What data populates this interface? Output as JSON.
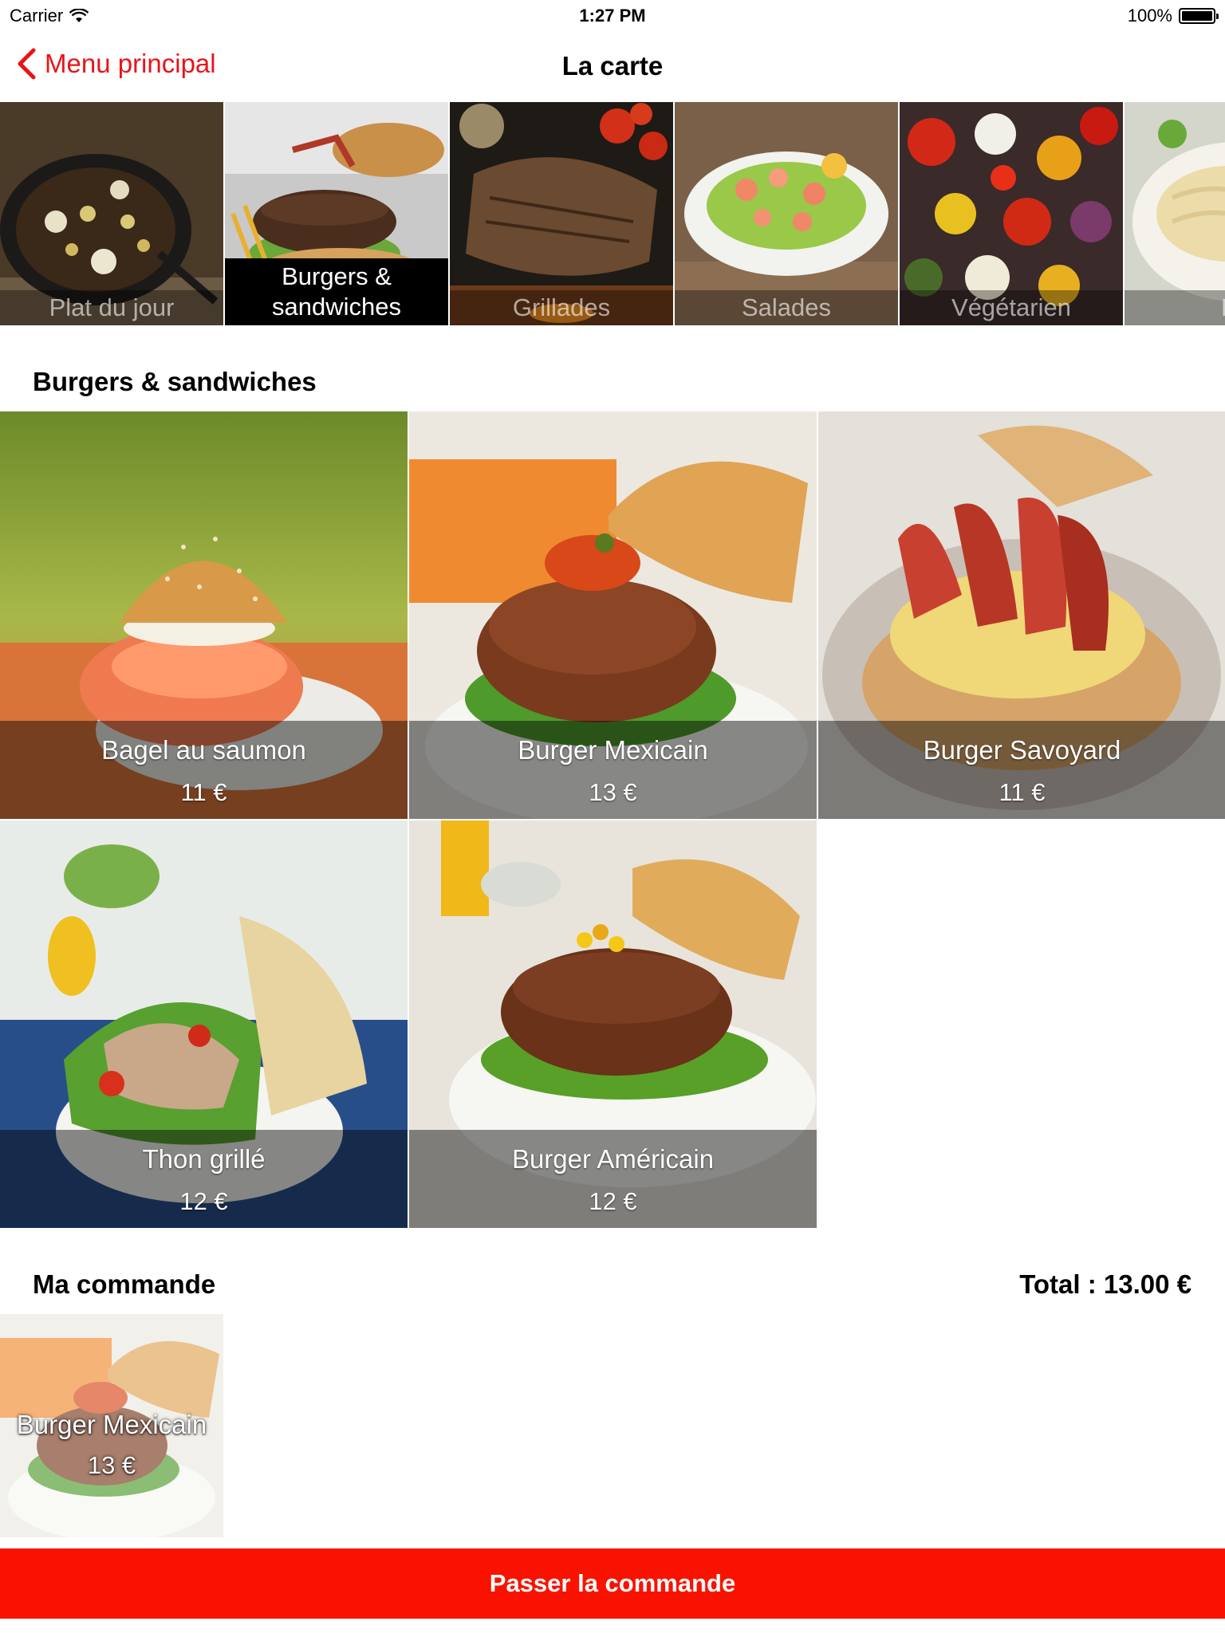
{
  "status_bar": {
    "carrier": "Carrier",
    "time": "1:27 PM",
    "battery": "100%",
    "wifi_icon": "wifi-icon",
    "battery_icon": "battery-icon"
  },
  "nav": {
    "back_label": "Menu principal",
    "back_icon": "chevron-left-icon",
    "title": "La carte",
    "accent_color": "#e8141b"
  },
  "categories": [
    {
      "label": "Plat du jour",
      "active": false
    },
    {
      "label": "Burgers & sandwiches",
      "active": true
    },
    {
      "label": "Grillades",
      "active": false
    },
    {
      "label": "Salades",
      "active": false
    },
    {
      "label": "Végétarien",
      "active": false
    },
    {
      "label": "Pâ",
      "active": false
    }
  ],
  "section": {
    "title": "Burgers & sandwiches"
  },
  "products": [
    {
      "name": "Bagel au saumon",
      "price": "11 €"
    },
    {
      "name": "Burger Mexicain",
      "price": "13 €"
    },
    {
      "name": "Burger Savoyard",
      "price": "11 €"
    },
    {
      "name": "Thon grillé",
      "price": "12 €"
    },
    {
      "name": "Burger Américain",
      "price": "12 €"
    }
  ],
  "order": {
    "title": "Ma commande",
    "total": "Total : 13.00 €",
    "items": [
      {
        "name": "Burger Mexicain",
        "price": "13 €"
      }
    ]
  },
  "submit": {
    "label": "Passer la commande",
    "color": "#fa1200"
  }
}
